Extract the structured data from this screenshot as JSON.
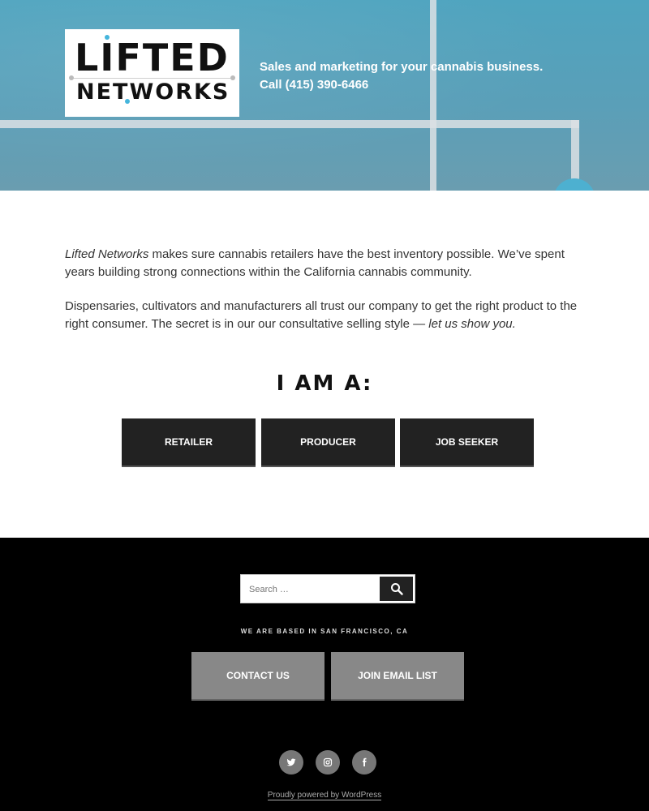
{
  "header": {
    "logo_line1": "LIFTED",
    "logo_line2": "NETWORKS",
    "tagline_line1": "Sales and marketing for your cannabis business.",
    "tagline_line2": "Call (415) 390-6466"
  },
  "intro": {
    "p1_em": "Lifted Networks",
    "p1_rest": " makes sure cannabis retailers have the best inventory possible. We’ve spent years building strong connections within the California cannabis community.",
    "p2_text": "Dispensaries, cultivators and manufacturers all trust our company to get the right product to the right consumer. The secret is in our our consultative selling style — ",
    "p2_em": "let us show you."
  },
  "iam": {
    "heading": "I AM A:",
    "choices": [
      {
        "label": "RETAILER"
      },
      {
        "label": "PRODUCER"
      },
      {
        "label": "JOB SEEKER"
      }
    ]
  },
  "footer": {
    "search_placeholder": "Search …",
    "based": "WE ARE BASED IN SAN FRANCISCO, CA",
    "contact_label": "CONTACT US",
    "email_label": "JOIN EMAIL LIST",
    "social": [
      "twitter-icon",
      "instagram-icon",
      "facebook-icon"
    ],
    "powered": "Proudly powered by WordPress"
  },
  "colors": {
    "header_blue": "#4fa4bf",
    "button_dark": "#222222",
    "footer_button_gray": "#888888",
    "footer_bg": "#000000"
  }
}
